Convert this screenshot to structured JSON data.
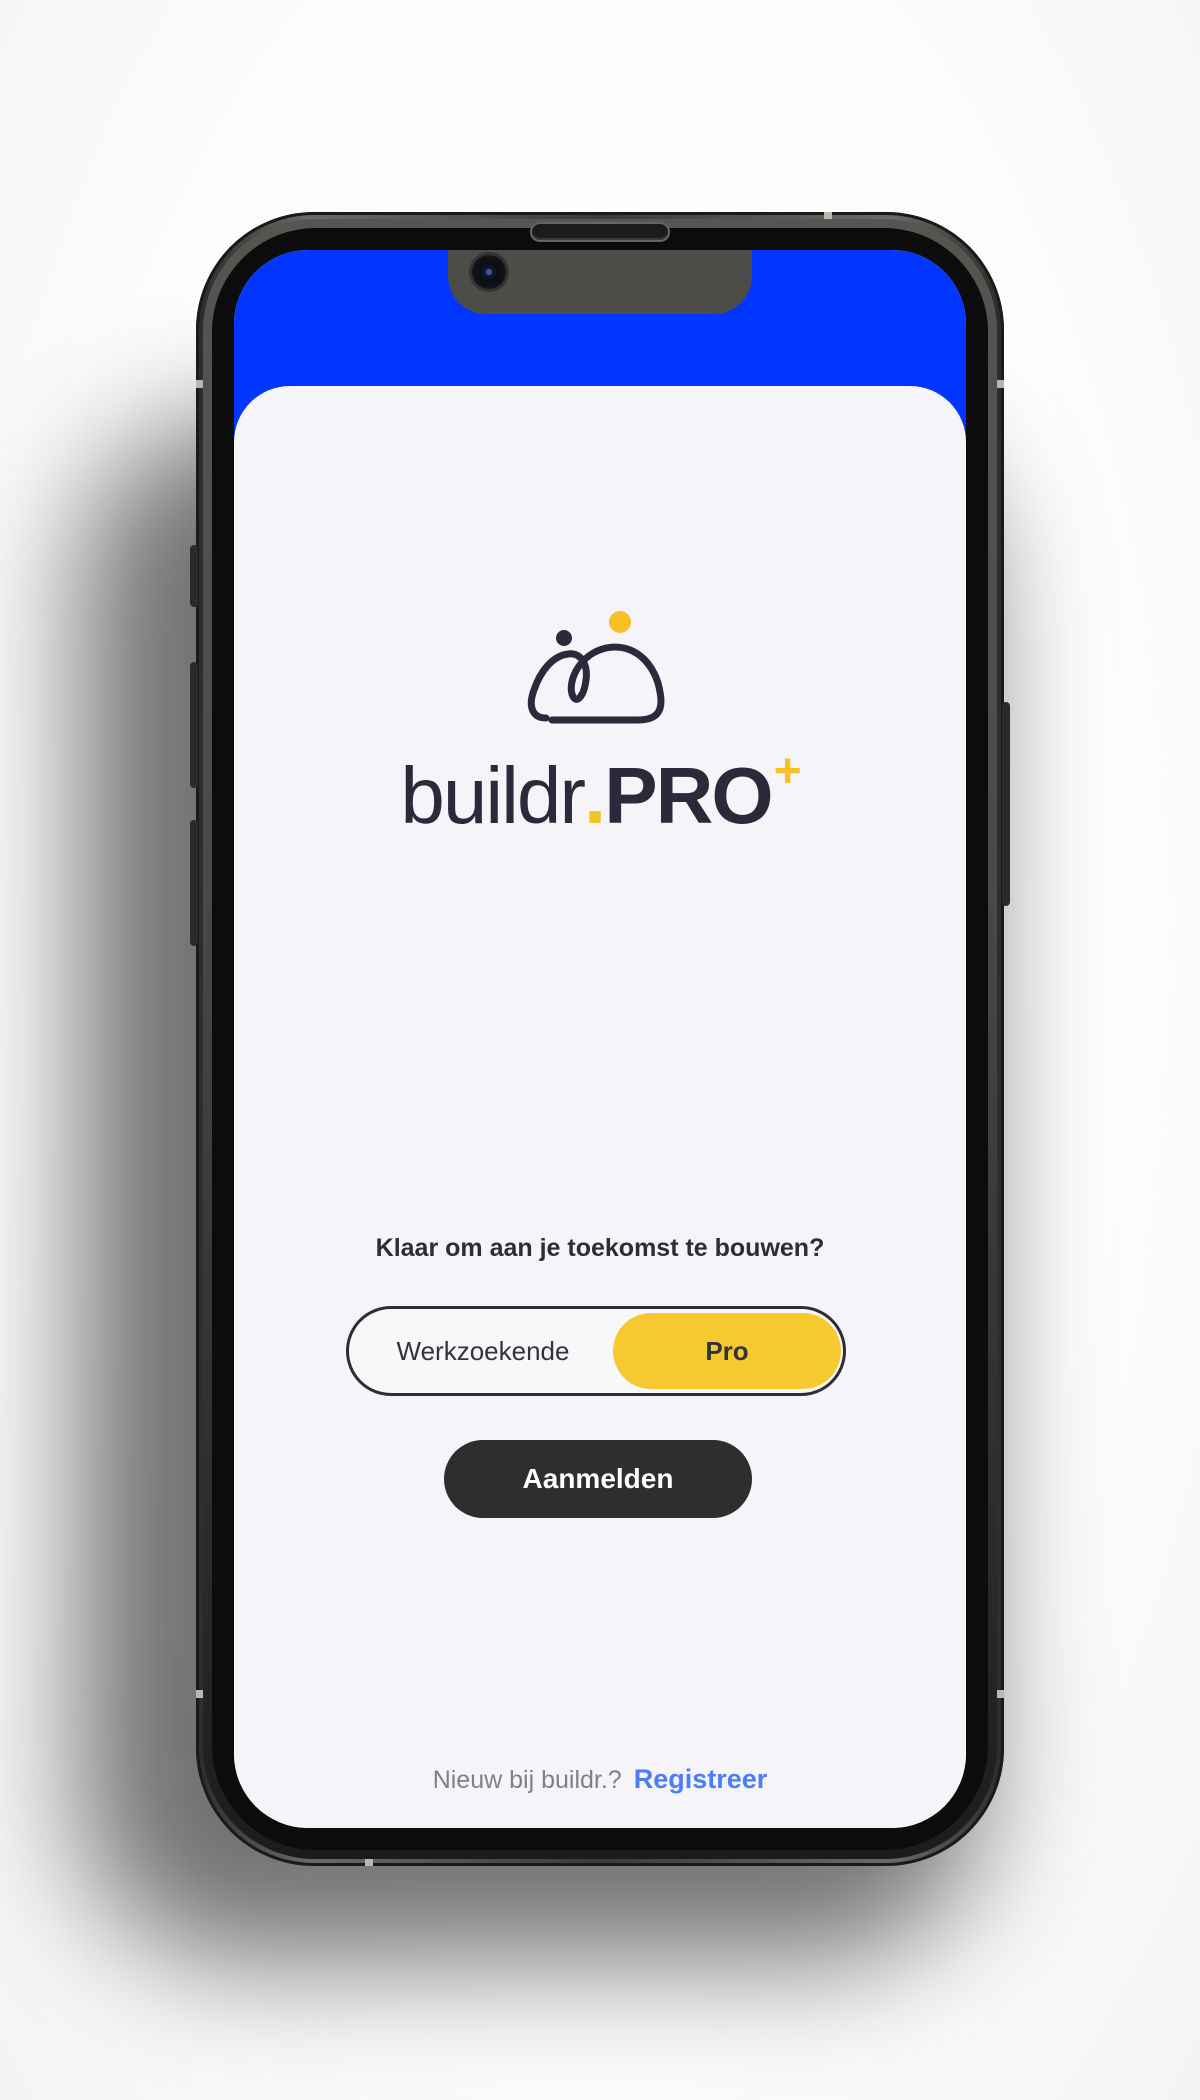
{
  "app": {
    "logo": {
      "word_main": "buildr",
      "word_dot": ".",
      "word_pro": "PRO",
      "word_plus": "+"
    },
    "tagline": "Klaar om aan je toekomst te bouwen?",
    "role_toggle": {
      "options": [
        "Werkzoekende",
        "Pro"
      ],
      "selected": "Pro"
    },
    "login_button": "Aanmelden",
    "footer": {
      "prompt": "Nieuw bij buildr.?",
      "register_link": "Registreer"
    }
  },
  "colors": {
    "header_blue": "#0036ff",
    "accent_yellow": "#f7c930",
    "dark": "#2e2e2e",
    "link_blue": "#4d7dff",
    "background": "#f4f4f9"
  },
  "icons": [
    "front-camera-icon",
    "buildr-logo-mark-icon"
  ]
}
